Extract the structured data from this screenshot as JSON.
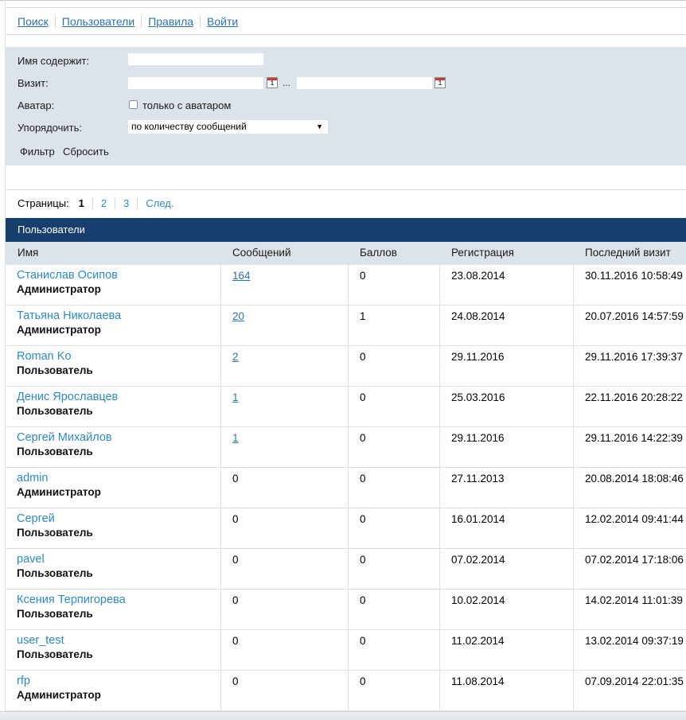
{
  "nav": {
    "links": [
      "Поиск",
      "Пользователи",
      "Правила",
      "Войти"
    ]
  },
  "filter": {
    "name_label": "Имя содержит:",
    "name_value": "",
    "visit_label": "Визит:",
    "visit_from": "",
    "visit_to": "",
    "visit_separator": "...",
    "calendar_glyph": "1",
    "avatar_label": "Аватар:",
    "avatar_checkbox_label": "только с аватаром",
    "avatar_checked": false,
    "order_label": "Упорядочить:",
    "order_selected": "по количеству сообщений",
    "filter_button": "Фильтр",
    "reset_button": "Сбросить"
  },
  "pager": {
    "label": "Страницы:",
    "pages": [
      "1",
      "2",
      "3"
    ],
    "current": "1",
    "next": "След."
  },
  "table": {
    "title": "Пользователи",
    "columns": [
      "Имя",
      "Сообщений",
      "Баллов",
      "Регистрация",
      "Последний визит"
    ],
    "rows": [
      {
        "name": "Станислав Осипов",
        "role": "Администратор",
        "posts": "164",
        "posts_link": true,
        "points": "0",
        "registered": "23.08.2014",
        "last_visit": "30.11.2016 10:58:49"
      },
      {
        "name": "Татьяна Николаева",
        "role": "Администратор",
        "posts": "20",
        "posts_link": true,
        "points": "1",
        "registered": "24.08.2014",
        "last_visit": "20.07.2016 14:57:59"
      },
      {
        "name": "Roman Ko",
        "role": "Пользователь",
        "posts": "2",
        "posts_link": true,
        "points": "0",
        "registered": "29.11.2016",
        "last_visit": "29.11.2016 17:39:37"
      },
      {
        "name": "Денис Ярославцев",
        "role": "Пользователь",
        "posts": "1",
        "posts_link": true,
        "points": "0",
        "registered": "25.03.2016",
        "last_visit": "22.11.2016 20:28:22"
      },
      {
        "name": "Сергей Михайлов",
        "role": "Пользователь",
        "posts": "1",
        "posts_link": true,
        "points": "0",
        "registered": "29.11.2016",
        "last_visit": "29.11.2016 14:22:39"
      },
      {
        "name": "admin",
        "role": "Администратор",
        "posts": "0",
        "posts_link": false,
        "points": "0",
        "registered": "27.11.2013",
        "last_visit": "20.08.2014 18:08:46"
      },
      {
        "name": "Сергей",
        "role": "Пользователь",
        "posts": "0",
        "posts_link": false,
        "points": "0",
        "registered": "16.01.2014",
        "last_visit": "12.02.2014 09:41:44"
      },
      {
        "name": "pavel",
        "role": "Пользователь",
        "posts": "0",
        "posts_link": false,
        "points": "0",
        "registered": "07.02.2014",
        "last_visit": "07.02.2014 17:18:06"
      },
      {
        "name": "Ксения Терпигорева",
        "role": "Пользователь",
        "posts": "0",
        "posts_link": false,
        "points": "0",
        "registered": "10.02.2014",
        "last_visit": "14.02.2014 11:01:39"
      },
      {
        "name": "user_test",
        "role": "Пользователь",
        "posts": "0",
        "posts_link": false,
        "points": "0",
        "registered": "11.02.2014",
        "last_visit": "13.02.2014 09:37:19"
      },
      {
        "name": "rfp",
        "role": "Администратор",
        "posts": "0",
        "posts_link": false,
        "points": "0",
        "registered": "11.08.2014",
        "last_visit": "07.09.2014 22:01:35"
      }
    ]
  },
  "colors": {
    "link": "#2c8ac8",
    "header_bar": "#173f6e",
    "panel_bg": "#dde3ea"
  }
}
